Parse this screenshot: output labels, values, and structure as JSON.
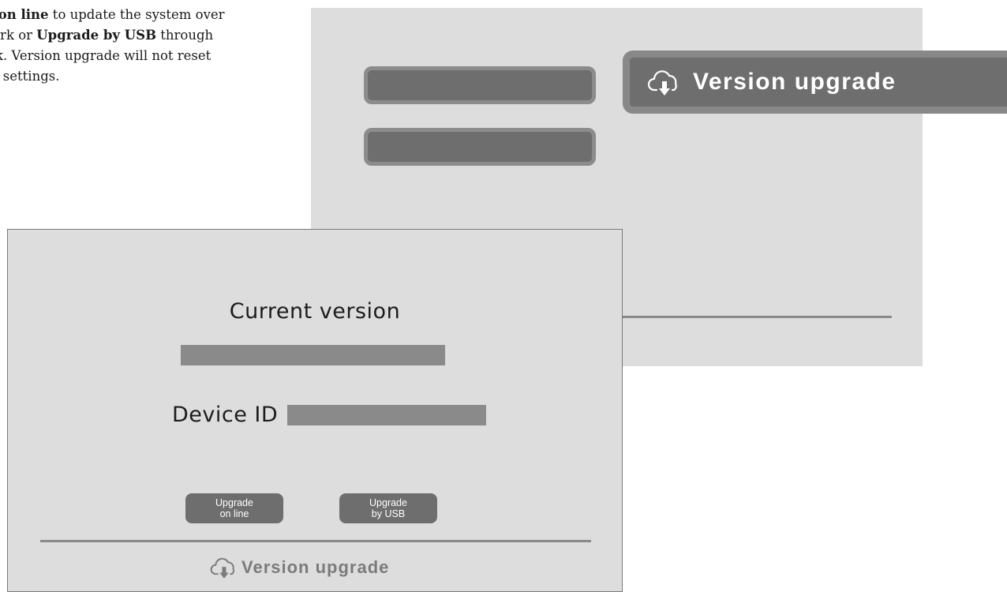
{
  "instructions": {
    "line1_bold": "de on line",
    "line1_rest": " to update the system over",
    "line2_pre": "work or ",
    "line2_bold": "Upgrade by USB",
    "line2_rest": " through",
    "line3": "k. Version upgrade will not reset",
    "line4": "on settings."
  },
  "menu": {
    "selected_label": "Version upgrade",
    "selected_icon": "cloud-download-icon"
  },
  "upgrade_panel": {
    "current_version_label": "Current version",
    "device_id_label": "Device ID",
    "buttons": {
      "online_line1": "Upgrade",
      "online_line2": "on line",
      "usb_line1": "Upgrade",
      "usb_line2": "by USB"
    },
    "footer_title": "Version upgrade",
    "footer_icon": "cloud-download-icon"
  },
  "colors": {
    "screen_bg": "#dcdddc",
    "button_bg": "#6e6e6e",
    "value_bar": "#8a8a8a"
  }
}
